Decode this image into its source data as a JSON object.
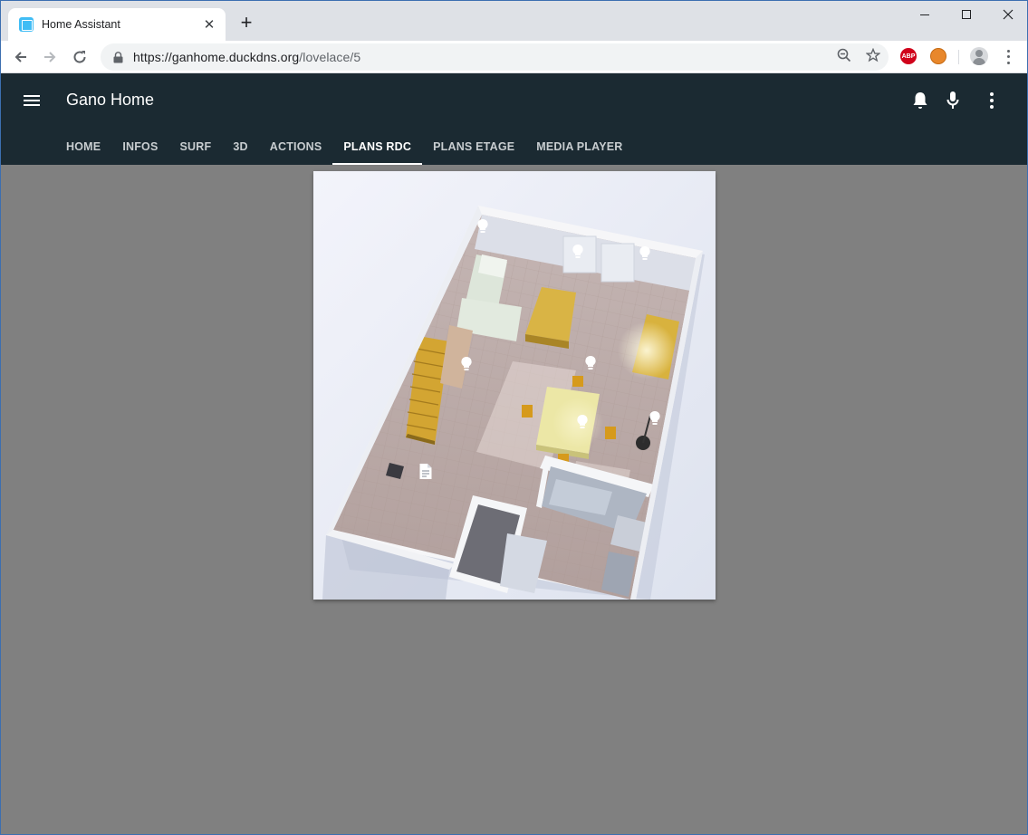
{
  "browser": {
    "tab_title": "Home Assistant",
    "tab_close": "✕",
    "new_tab": "+",
    "url_host": "https://ganhome.duckdns.org",
    "url_path": "/lovelace/5",
    "abp_label": "ABP"
  },
  "app": {
    "title": "Gano Home",
    "tabs": [
      {
        "label": "Home"
      },
      {
        "label": "Infos"
      },
      {
        "label": "Surf"
      },
      {
        "label": "3D"
      },
      {
        "label": "Actions"
      },
      {
        "label": "Plans RDC"
      },
      {
        "label": "Plans Etage"
      },
      {
        "label": "Media Player"
      }
    ],
    "active_tab": "Plans RDC",
    "actions": [
      "bell-icon",
      "microphone-icon",
      "more-vert-icon"
    ]
  },
  "floorplan": {
    "icons": [
      "lightbulb-icon",
      "lightbulb-icon",
      "lightbulb-icon",
      "lightbulb-icon",
      "lightbulb-icon",
      "lightbulb-icon",
      "lightbulb-icon",
      "document-icon"
    ]
  },
  "colors": {
    "header": "#1b2a32",
    "content_bg": "#808080",
    "ha_blue": "#41bdf5"
  }
}
